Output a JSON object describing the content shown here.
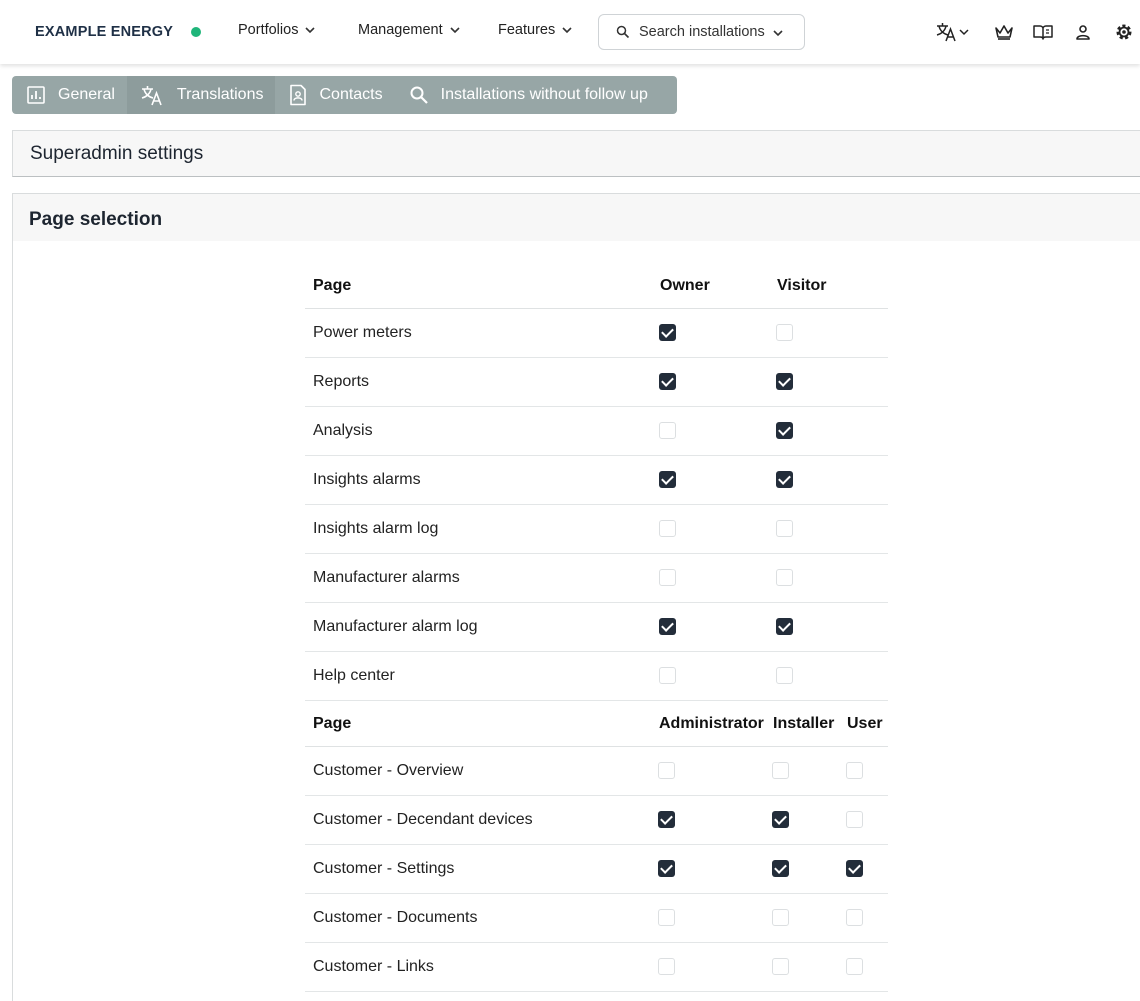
{
  "brand": {
    "name": "EXAMPLE ENERGY",
    "status_color": "#1fb57a"
  },
  "nav": {
    "menus": [
      {
        "label": "Portfolios"
      },
      {
        "label": "Management"
      },
      {
        "label": "Features"
      }
    ],
    "search_label": "Search installations"
  },
  "tabs": [
    {
      "label": "General",
      "icon": "chart-icon"
    },
    {
      "label": "Translations",
      "icon": "translate-icon"
    },
    {
      "label": "Contacts",
      "icon": "contact-icon"
    },
    {
      "label": "Installations without follow up",
      "icon": "search-icon"
    }
  ],
  "superadmin": {
    "title": "Superadmin settings"
  },
  "page_selection": {
    "title": "Page selection",
    "table1": {
      "headers": [
        "Page",
        "Owner",
        "Visitor"
      ],
      "rows": [
        {
          "page": "Power meters",
          "checks": [
            true,
            false
          ]
        },
        {
          "page": "Reports",
          "checks": [
            true,
            true
          ]
        },
        {
          "page": "Analysis",
          "checks": [
            false,
            true
          ]
        },
        {
          "page": "Insights alarms",
          "checks": [
            true,
            true
          ]
        },
        {
          "page": "Insights alarm log",
          "checks": [
            false,
            false
          ]
        },
        {
          "page": "Manufacturer alarms",
          "checks": [
            false,
            false
          ]
        },
        {
          "page": "Manufacturer alarm log",
          "checks": [
            true,
            true
          ]
        },
        {
          "page": "Help center",
          "checks": [
            false,
            false
          ]
        }
      ]
    },
    "table2": {
      "headers": [
        "Page",
        "Administrator",
        "Installer",
        "User"
      ],
      "rows": [
        {
          "page": "Customer - Overview",
          "checks": [
            false,
            false,
            false
          ]
        },
        {
          "page": "Customer - Decendant devices",
          "checks": [
            true,
            true,
            false
          ]
        },
        {
          "page": "Customer - Settings",
          "checks": [
            true,
            true,
            true
          ]
        },
        {
          "page": "Customer - Documents",
          "checks": [
            false,
            false,
            false
          ]
        },
        {
          "page": "Customer - Links",
          "checks": [
            false,
            false,
            false
          ]
        }
      ]
    }
  }
}
